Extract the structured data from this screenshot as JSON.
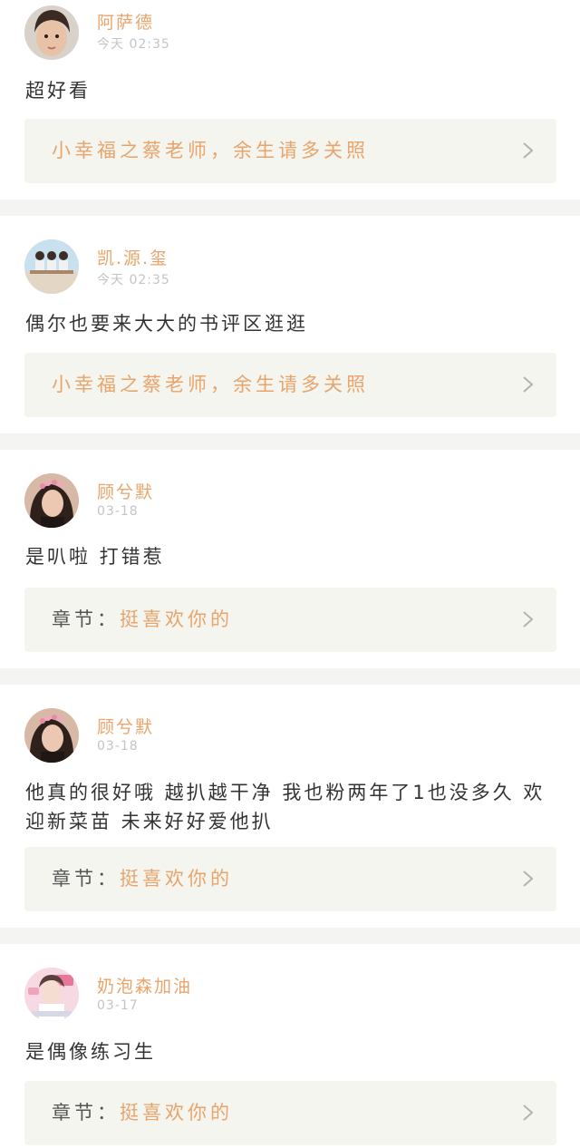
{
  "colors": {
    "accent": "#e8a46b",
    "text": "#333333",
    "muted": "#c4c4c4",
    "card_bg": "#f5f5ef",
    "separator": "#f4f4f2"
  },
  "comments": [
    {
      "user": "阿萨德",
      "time": "今天 02:35",
      "text": "超好看",
      "card": {
        "prefix": "",
        "title": "小幸福之蔡老师，余生请多关照"
      }
    },
    {
      "user": "凯.源.玺",
      "time": "今天 02:35",
      "text": "偶尔也要来大大的书评区逛逛",
      "card": {
        "prefix": "",
        "title": "小幸福之蔡老师，余生请多关照"
      }
    },
    {
      "user": "顾兮默",
      "time": "03-18",
      "text": "是叭啦 打错惹",
      "card": {
        "prefix": "章节：",
        "title": "挺喜欢你的"
      }
    },
    {
      "user": "顾兮默",
      "time": "03-18",
      "text": "他真的很好哦 越扒越干净 我也粉两年了1也没多久 欢迎新菜苗 未来好好爱他扒",
      "card": {
        "prefix": "章节：",
        "title": "挺喜欢你的"
      }
    },
    {
      "user": "奶泡森加油",
      "time": "03-17",
      "text": "是偶像练习生",
      "card": {
        "prefix": "章节：",
        "title": "挺喜欢你的"
      }
    }
  ]
}
